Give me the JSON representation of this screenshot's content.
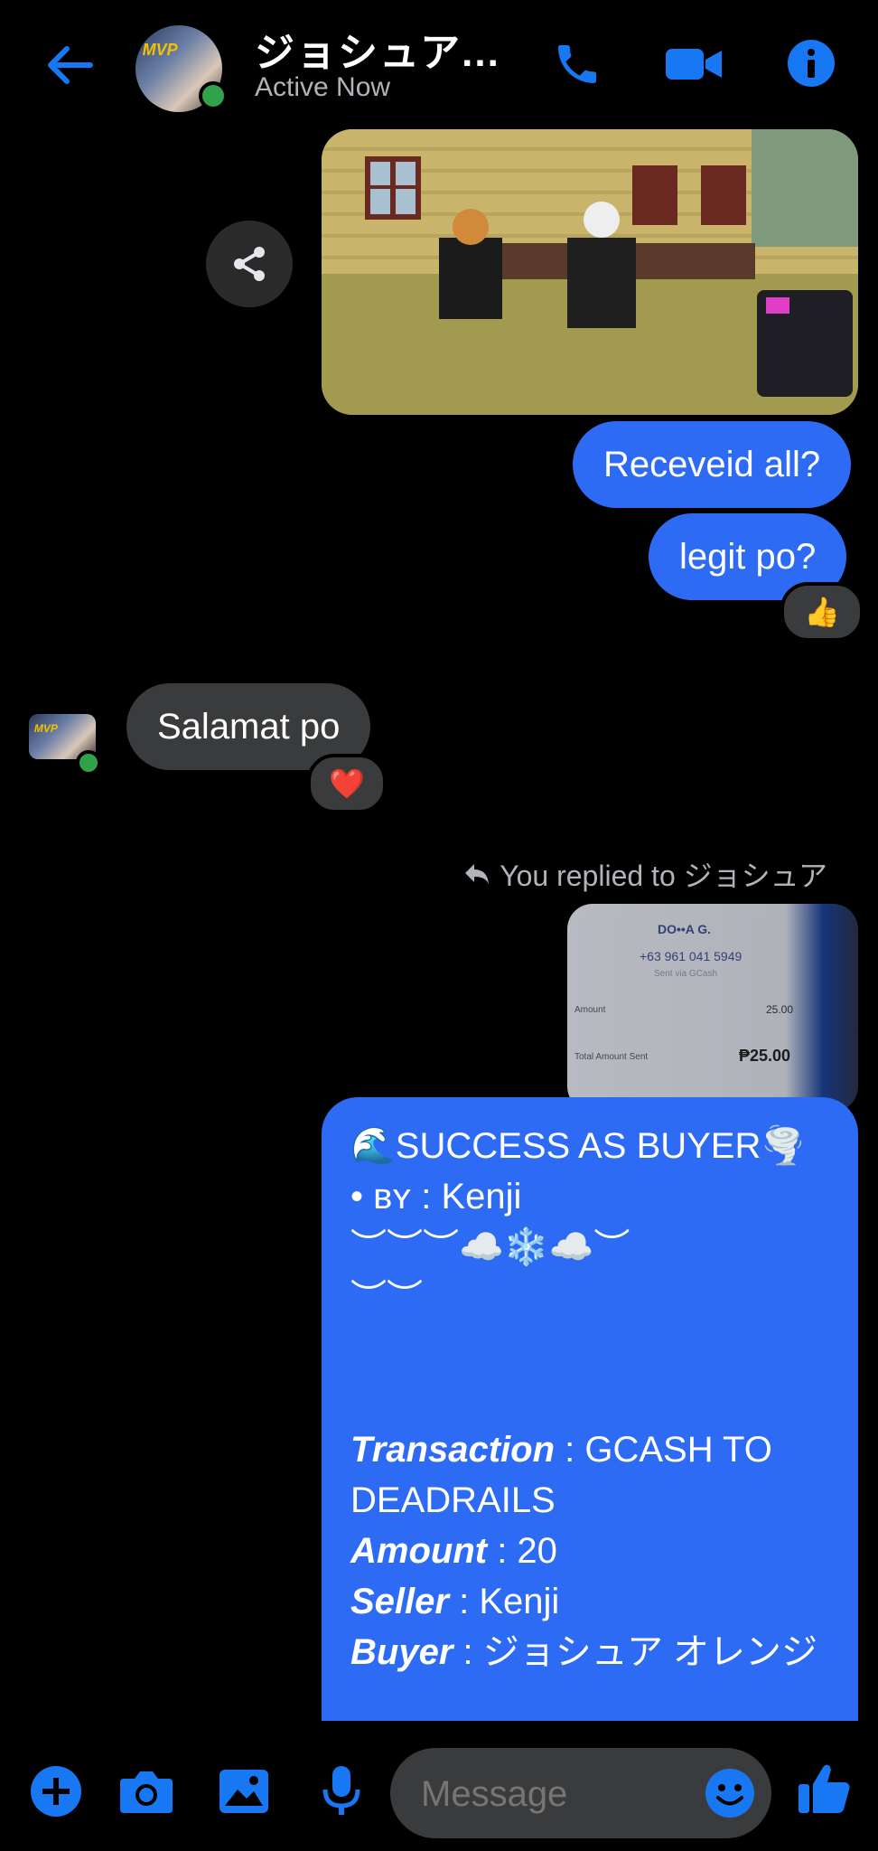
{
  "header": {
    "title": "ジョシュア...",
    "status": "Active Now",
    "avatar_badge": "MVP"
  },
  "messages": {
    "sent_1": "Receveid all?",
    "sent_2": "legit po?",
    "sent_2_reaction": "👍",
    "received_1": "Salamat po",
    "received_1_reaction": "❤️",
    "replied_label": "You replied to ジョシュア"
  },
  "quoted_receipt": {
    "name": "DO••A G.",
    "phone": "+63 961 041 5949",
    "sent_via": "Sent via GCash",
    "amount_label": "Amount",
    "amount": "25.00",
    "total_label": "Total Amount Sent",
    "total": "₱25.00"
  },
  "big_message": {
    "line1": "🌊SUCCESS AS BUYER🌪️",
    "line2": "• ʙʏ : Kenji",
    "line3": "︶︶︶☁️❄️☁️︶",
    "line4": "︶︶",
    "transaction_label": "Transaction",
    "transaction_value": ": GCASH TO DEADRAILS",
    "amount_label": "Amount",
    "amount_value": ": 20",
    "seller_label": "Seller",
    "seller_value": ": Kenji",
    "buyer_label": "Buyer",
    "buyer_value": ": ジョシュア オレンジ"
  },
  "composer": {
    "placeholder": "Message"
  },
  "colors": {
    "accent": "#2d6bf5",
    "icon_blue": "#1877f2",
    "online": "#31a24c",
    "bubble_gray": "#3a3b3c"
  }
}
